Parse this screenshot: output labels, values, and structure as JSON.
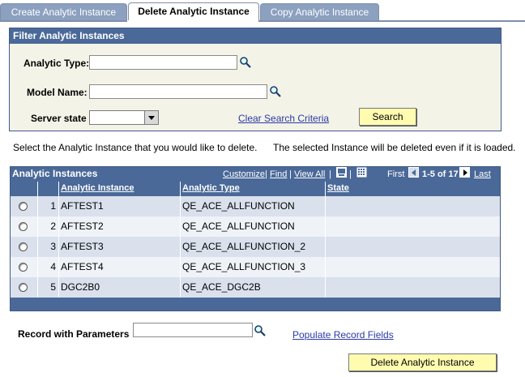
{
  "tabs": [
    {
      "label": "Create Analytic Instance",
      "active": false
    },
    {
      "label": "Delete Analytic Instance",
      "active": true
    },
    {
      "label": "Copy Analytic Instance",
      "active": false
    }
  ],
  "filter": {
    "title": "Filter Analytic Instances",
    "analytic_type_label": "Analytic Type:",
    "analytic_type_value": "",
    "model_name_label": "Model Name:",
    "model_name_value": "",
    "server_state_label": "Server state",
    "server_state_value": "",
    "clear_link": "Clear Search Criteria",
    "search_button": "Search"
  },
  "instructions": {
    "left": "Select the Analytic Instance that you would like to delete.",
    "right": "The selected Instance will be deleted even if it is loaded."
  },
  "grid": {
    "title": "Analytic Instances",
    "customize": "Customize",
    "find": "Find",
    "view_all": "View All",
    "sep": "|",
    "first": "First",
    "range": "1-5 of 17",
    "last": "Last",
    "columns": [
      "Analytic Instance",
      "Analytic Type",
      "State"
    ],
    "rows": [
      {
        "num": "1",
        "instance": "AFTEST1",
        "type": "QE_ACE_ALLFUNCTION",
        "state": ""
      },
      {
        "num": "2",
        "instance": "AFTEST2",
        "type": "QE_ACE_ALLFUNCTION",
        "state": ""
      },
      {
        "num": "3",
        "instance": "AFTEST3",
        "type": "QE_ACE_ALLFUNCTION_2",
        "state": ""
      },
      {
        "num": "4",
        "instance": "AFTEST4",
        "type": "QE_ACE_ALLFUNCTION_3",
        "state": ""
      },
      {
        "num": "5",
        "instance": "DGC2B0",
        "type": "QE_ACE_DGC2B",
        "state": ""
      }
    ]
  },
  "record": {
    "label": "Record with Parameters",
    "value": "",
    "populate_link": "Populate Record Fields"
  },
  "delete_button": "Delete Analytic Instance",
  "colors": {
    "header_blue": "#4a6998",
    "row_odd": "#dae1ed",
    "row_even": "#eff2f7",
    "button_yellow": "#fffcb0",
    "link": "#2a3aa5"
  },
  "icons": [
    "search-icon",
    "dropdown-arrow-icon",
    "previous-arrow-icon",
    "next-arrow-icon",
    "download-icon",
    "zoom-grid-icon"
  ]
}
